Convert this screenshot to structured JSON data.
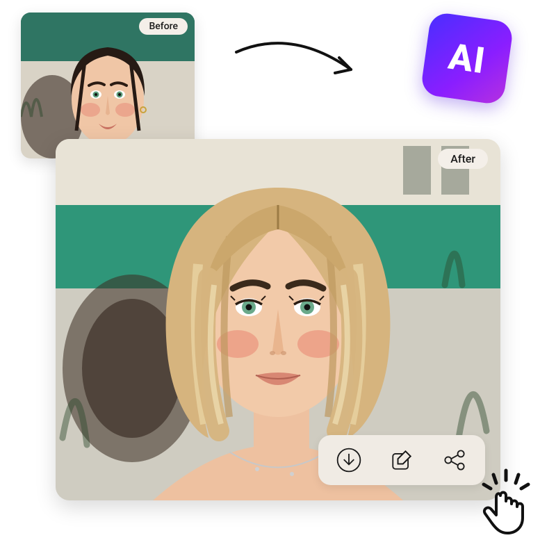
{
  "labels": {
    "before": "Before",
    "after": "After"
  },
  "ai_badge": {
    "text": "AI",
    "gradient_start": "#4a2eff",
    "gradient_end": "#b530e0"
  },
  "toolbar": {
    "download": {
      "label": "Download",
      "icon": "download-icon"
    },
    "edit": {
      "label": "Edit",
      "icon": "edit-icon"
    },
    "share": {
      "label": "Share",
      "icon": "share-icon"
    }
  },
  "images": {
    "before": {
      "description": "Portrait of a woman with dark hair pulled back, green eyes, outdoor café background",
      "hair_color": "dark brown"
    },
    "after": {
      "description": "Same portrait transformed; woman now has a blonde bob haircut",
      "hair_color": "blonde"
    }
  },
  "decorations": {
    "arrow": "curved-arrow-icon",
    "click_hand": "click-pointer-icon"
  }
}
